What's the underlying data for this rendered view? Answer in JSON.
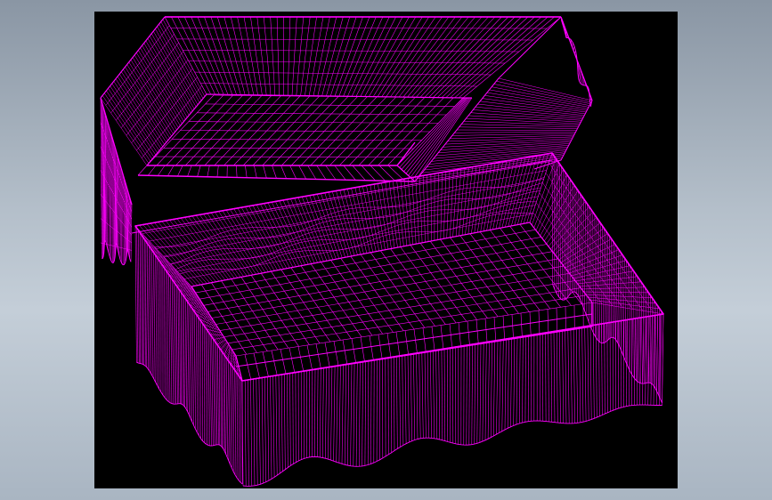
{
  "colors": {
    "background_gradient_top": "#8a96a4",
    "background_gradient_bottom": "#c4ced8",
    "viewport": "#000000",
    "wireframe": "#ff00ff"
  },
  "scene": {
    "subject": "wireframe-mesh",
    "object_count": 2
  }
}
